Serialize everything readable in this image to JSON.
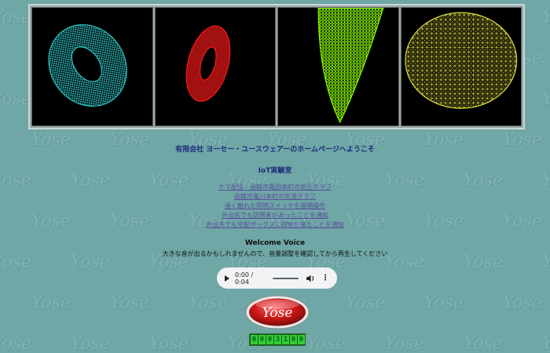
{
  "watermark": {
    "text": "Yose"
  },
  "banner": {
    "panels": [
      {
        "shape": "torus-wireframe",
        "color": "#2fc4c4"
      },
      {
        "shape": "torus-wireframe",
        "color": "#ff1a1a"
      },
      {
        "shape": "cone-wireframe",
        "color": "#8cff00"
      },
      {
        "shape": "ellipsoid-wireframe",
        "color": "#e0e040"
      }
    ]
  },
  "header": {
    "company_title": "有限会社 ヨーセー・ユースウェアーのホームページへようこそ",
    "lab_title": "IoT実験室"
  },
  "links": [
    "ナマ配信 - 函館市亀田本町の気圧グラフ",
    "函館市亀川本町の気温グラフ",
    "遠く離れた照明スイッチを遠隔操作",
    "外出先でも訪問者があったことを通知",
    "外出先でも宅配ボックスに荷物が来たことを通知"
  ],
  "welcome": {
    "title": "Welcome Voice",
    "notice": "大きな音が出るかもしれませんので、音量調整を確認してから再生してください"
  },
  "audio": {
    "time": "0:00 / 0:04",
    "play_icon": "play-icon",
    "volume_icon": "volume-icon",
    "more_icon": "more-vert-icon"
  },
  "logo": {
    "text": "Yose",
    "color": "#cc1a1a"
  },
  "counter": {
    "digits": [
      "0",
      "0",
      "0",
      "3",
      "1",
      "0",
      "0"
    ]
  }
}
